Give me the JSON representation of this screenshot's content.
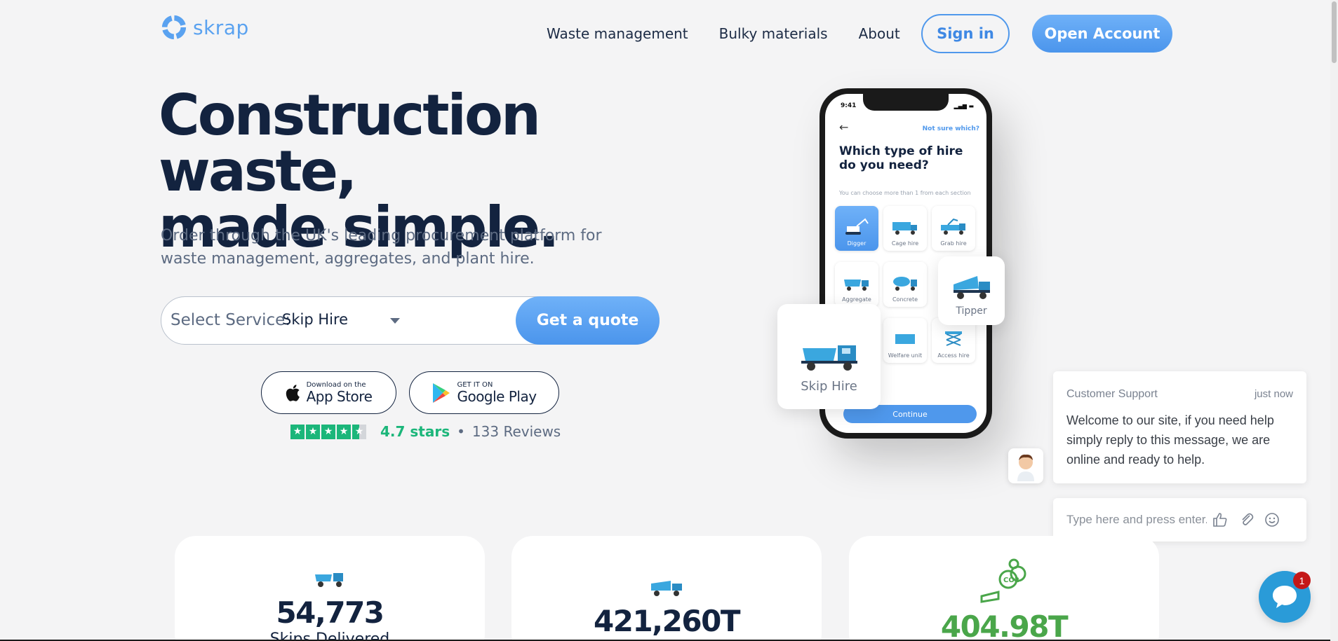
{
  "brand": {
    "name": "skrap",
    "accent": "#4f98ec",
    "dark": "#13233f",
    "green": "#1bb67a"
  },
  "nav": {
    "links": [
      "Waste management",
      "Bulky materials",
      "About"
    ],
    "sign_in": "Sign in",
    "open_account": "Open Account"
  },
  "hero": {
    "title_line1": "Construction waste,",
    "title_line2": "made simple.",
    "subtitle": "Order through the UK's leading procurement platform for waste management, aggregates, and plant hire.",
    "service_label": "Select Service:",
    "service_value": "Skip Hire",
    "quote_button": "Get a quote"
  },
  "stores": {
    "apple_small": "Download on the",
    "apple_big": "App Store",
    "google_small": "GET IT ON",
    "google_big": "Google Play"
  },
  "rating": {
    "stars": 4.5,
    "score": "4.7 stars",
    "separator": "•",
    "count": "133 Reviews"
  },
  "phone": {
    "time": "9:41",
    "not_sure": "Not sure which?",
    "title": "Which type of hire do you need?",
    "hint": "You can choose more than 1 from each section",
    "tiles": [
      "Digger",
      "Cage hire",
      "Grab hire",
      "Aggregate",
      "Concrete",
      "Welfare unit",
      "Access hire"
    ],
    "continue": "Continue"
  },
  "floating_cards": {
    "tipper": "Tipper",
    "skip_hire": "Skip Hire"
  },
  "chat": {
    "from": "Customer Support",
    "time": "just now",
    "message": "Welcome to our site, if you need help simply reply to this message, we are online and ready to help.",
    "input_placeholder": "Type here and press enter..",
    "badge_count": "1"
  },
  "stats": [
    {
      "value": "54,773",
      "label": "Skips Delivered"
    },
    {
      "value": "421,260T",
      "label": ""
    },
    {
      "value": "404.98T",
      "label": ""
    }
  ]
}
